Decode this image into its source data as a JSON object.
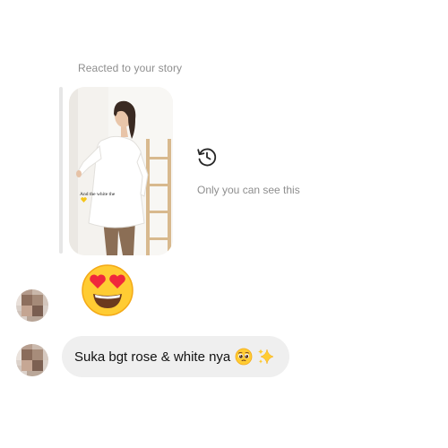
{
  "story_reply": {
    "label": "Reacted to your story",
    "story_caption": "And the white the",
    "caption_emoji": "yellow-heart-emoji",
    "private_notice": "Only you can see this",
    "private_notice_icon": "history-icon"
  },
  "reaction": {
    "emoji": "heart-eyes-emoji"
  },
  "message": {
    "text": "Suka bgt rose & white nya",
    "emojis": [
      "pleading-face-emoji",
      "sparkles-emoji"
    ]
  },
  "colors": {
    "bubble": "#efefef",
    "secondary_text": "#8e8e8e",
    "quote_bar": "#e6e6e6"
  }
}
